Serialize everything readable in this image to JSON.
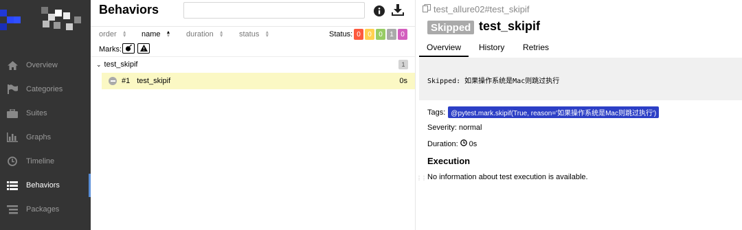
{
  "sidebar": {
    "items": [
      {
        "label": "Overview",
        "icon": "home-icon"
      },
      {
        "label": "Categories",
        "icon": "flag-icon"
      },
      {
        "label": "Suites",
        "icon": "briefcase-icon"
      },
      {
        "label": "Graphs",
        "icon": "bar-chart-icon"
      },
      {
        "label": "Timeline",
        "icon": "clock-icon"
      },
      {
        "label": "Behaviors",
        "icon": "list-icon",
        "active": true
      },
      {
        "label": "Packages",
        "icon": "packages-icon"
      }
    ]
  },
  "behaviors": {
    "title": "Behaviors",
    "search_value": "",
    "columns": {
      "order": "order",
      "name": "name",
      "duration": "duration",
      "status": "status"
    },
    "status_label": "Status:",
    "status_counts": [
      {
        "value": "0",
        "color": "#fd5a3e"
      },
      {
        "value": "0",
        "color": "#ffd050"
      },
      {
        "value": "0",
        "color": "#97cc64"
      },
      {
        "value": "1",
        "color": "#aaaaaa"
      },
      {
        "value": "0",
        "color": "#d35ebe"
      }
    ],
    "marks_label": "Marks:",
    "group": {
      "name": "test_skipif",
      "count": "1"
    },
    "case": {
      "number": "#1",
      "name": "test_skipif",
      "duration": "0s"
    }
  },
  "detail": {
    "breadcrumb": "test_allure02#test_skipif",
    "status_badge": "Skipped",
    "title": "test_skipif",
    "tabs": [
      "Overview",
      "History",
      "Retries"
    ],
    "skip_message": "Skipped: 如果操作系统是Mac则跳过执行",
    "tags_label": "Tags:",
    "tag": "@pytest.mark.skipif(True, reason='如果操作系统是Mac则跳过执行')",
    "severity": "Severity: normal",
    "duration_label": "Duration:",
    "duration": "0s",
    "execution_title": "Execution",
    "execution_info": "No information about test execution is available."
  }
}
